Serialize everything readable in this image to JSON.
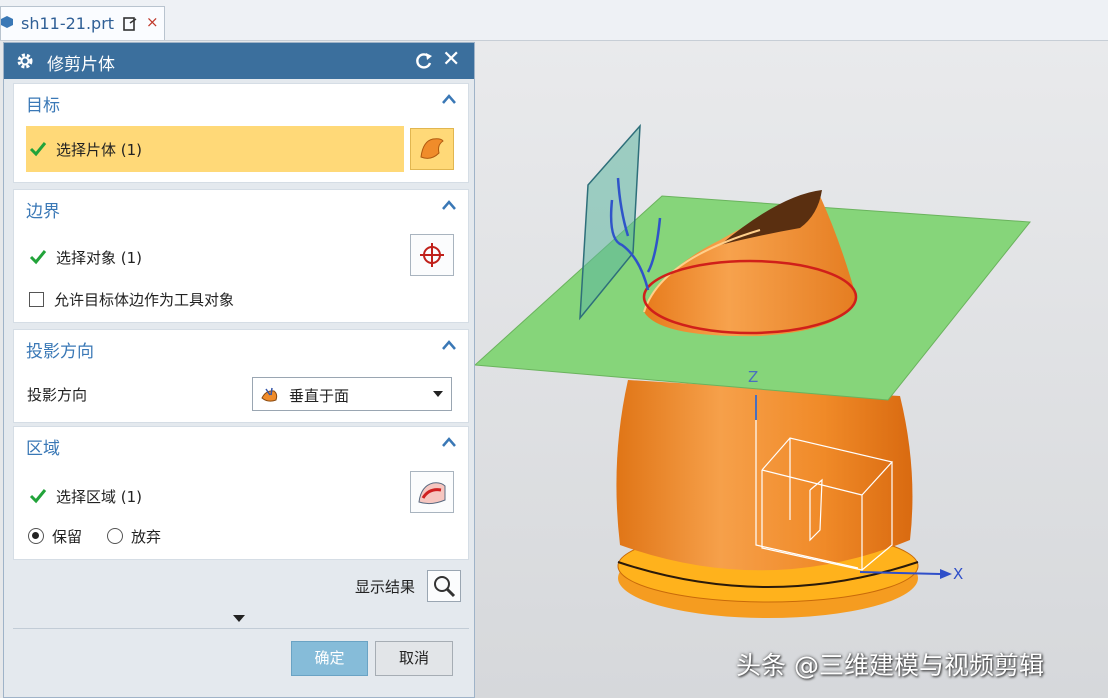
{
  "tab": {
    "title": "sh11-21.prt",
    "close": "×"
  },
  "dialog": {
    "title": "修剪片体",
    "close": "✕",
    "groups": [
      {
        "title": "目标",
        "select_label": "选择片体 (1)"
      },
      {
        "title": "边界",
        "select_label": "选择对象 (1)",
        "checkbox_label": "允许目标体边作为工具对象",
        "checkbox_checked": false
      },
      {
        "title": "投影方向",
        "field_label": "投影方向",
        "dropdown_value": "垂直于面"
      },
      {
        "title": "区域",
        "select_label": "选择区域 (1)",
        "options": [
          "保留",
          "放弃"
        ],
        "selected": "保留"
      }
    ],
    "show_result_label": "显示结果",
    "ok_label": "确定",
    "cancel_label": "取消"
  },
  "viewport": {
    "axis_z": "Z",
    "axis_x": "X"
  },
  "watermark": "头条 @三维建模与视频剪辑",
  "colors": {
    "header": "#3b6f9d",
    "highlight": "#ffd978",
    "accent": "#3a78b6",
    "surface": "#f08c2a",
    "plane": "#8ad37a"
  }
}
